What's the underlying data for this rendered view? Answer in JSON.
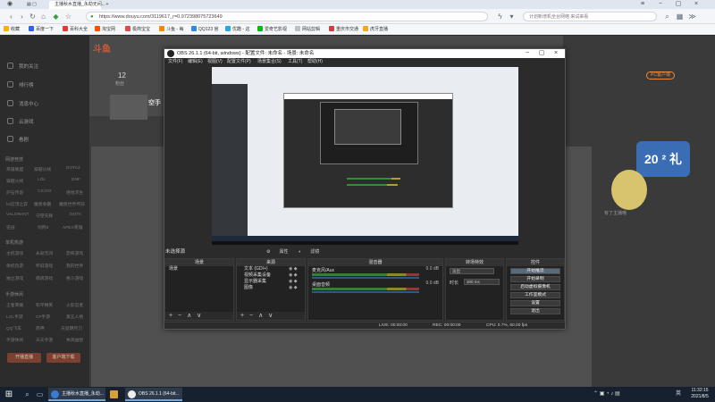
{
  "browser": {
    "tab_title": "主播秋水直播_永劫无间...",
    "new_tab": "+",
    "url": "https://www.douyu.com/3119617_r=0.972398075723649",
    "search_placeholder": "计划新增机全台网络 来试来看",
    "bookmarks": [
      {
        "label": "收藏",
        "color": "#f5b400"
      },
      {
        "label": "百度一下",
        "color": "#3061f2"
      },
      {
        "label": "百科大全",
        "color": "#e03a3a"
      },
      {
        "label": "淘宝网",
        "color": "#ff5000"
      },
      {
        "label": "极简宝宝",
        "color": "#e04a4a"
      },
      {
        "label": "斗鱼 - 每",
        "color": "#f08a00"
      },
      {
        "label": "QQ123 官",
        "color": "#2a8ae6"
      },
      {
        "label": "优酷 - 这",
        "color": "#2aa6e6"
      },
      {
        "label": "爱奇艺影视",
        "color": "#00be06"
      },
      {
        "label": "网站剪辑",
        "color": "#c0c0c0"
      },
      {
        "label": "重庆市交通",
        "color": "#d04040"
      },
      {
        "label": "虎牙直播",
        "color": "#f5a623"
      }
    ]
  },
  "douyu": {
    "logo": "斗鱼",
    "nav": [
      "我的关注",
      "排行榜",
      "消息中心",
      "云游戏",
      "看剧"
    ],
    "sections": [
      "网游竞技",
      "单机热游",
      "手游休闲"
    ],
    "categories": [
      [
        "英雄联盟",
        "穿越火线",
        "DOTA2"
      ],
      [
        "穿越火线",
        "LOL",
        "DNF"
      ],
      [
        "炉石传说",
        "CS:GO",
        "绝地求生"
      ],
      [
        "lol云顶之弈",
        "魔兽争霸",
        "魔兽世界怀旧"
      ],
      [
        "VALORANT",
        "守望先锋",
        "DOTA"
      ],
      [
        "逆战",
        "剑网3",
        "APEX英雄"
      ],
      [
        "主机游戏",
        "永劫无间",
        "恐怖游戏"
      ],
      [
        "单机热游",
        "怀旧游戏",
        "我的世界"
      ],
      [
        "独立游戏",
        "棋牌游戏",
        "格斗游戏"
      ],
      [
        "王者荣耀",
        "和平精英",
        "火影忍者"
      ],
      [
        "LOL手游",
        "CF手游",
        "第五人格"
      ],
      [
        "QQ飞车",
        "原神",
        "天涯明月刀"
      ],
      [
        "手游休闲",
        "天天手游",
        "休闲益智"
      ]
    ],
    "buttons": [
      "开播直播",
      "客户端下载"
    ],
    "viewer_count": "12",
    "viewer_label": "粉丝",
    "room_title": "空手",
    "pc_badge": "PC客户端",
    "promo": "20 ² 礼",
    "mascot_caption": "有了主播哦"
  },
  "obs": {
    "title": "OBS 26.1.1 (64-bit, windows) - 配置文件: 未命名 - 场景: 未命名",
    "menu": [
      "文件(F)",
      "编辑(E)",
      "视图(V)",
      "配置文件(P)",
      "场景集合(S)",
      "工具(T)",
      "帮助(H)"
    ],
    "scene_label": "未选择源",
    "source_tabs": [
      "属性",
      "滤镜"
    ],
    "docks": {
      "scenes": "场景",
      "sources": "来源",
      "mixer": "混音器",
      "transitions": "转场特效",
      "controls": "控件"
    },
    "scene_items": [
      "场景"
    ],
    "source_items": [
      "文本 (GDI+)",
      "视频采集设备",
      "显示器采集",
      "图像"
    ],
    "mixer_channels": [
      {
        "name": "麦克风/Aux",
        "value": "0.0 dB"
      },
      {
        "name": "桌面音频",
        "value": "0.0 dB"
      }
    ],
    "transition": {
      "type": "淡出",
      "duration_label": "时长",
      "duration": "300 ms"
    },
    "controls": [
      "开始推流",
      "开始录制",
      "启动虚拟摄像机",
      "工作室模式",
      "设置",
      "退出"
    ],
    "status": {
      "live": "LIVE: 00:00:00",
      "rec": "REC: 00:00:00",
      "cpu": "CPU: 0.7%, 60.00 fps"
    },
    "footer_ctrls": "+ − ∧ ∨"
  },
  "taskbar": {
    "tasks": [
      {
        "label": "主播秋水直播_永劫...",
        "color": "#3a7bd5"
      },
      {
        "label": "",
        "color": "#d8a03a"
      },
      {
        "label": "",
        "color": "#d04040"
      },
      {
        "label": "OBS 26.1.1 (64-bit...",
        "color": "#eeeeee"
      }
    ],
    "time": "11:32:15",
    "date": "2021/8/5",
    "ime": "英"
  }
}
